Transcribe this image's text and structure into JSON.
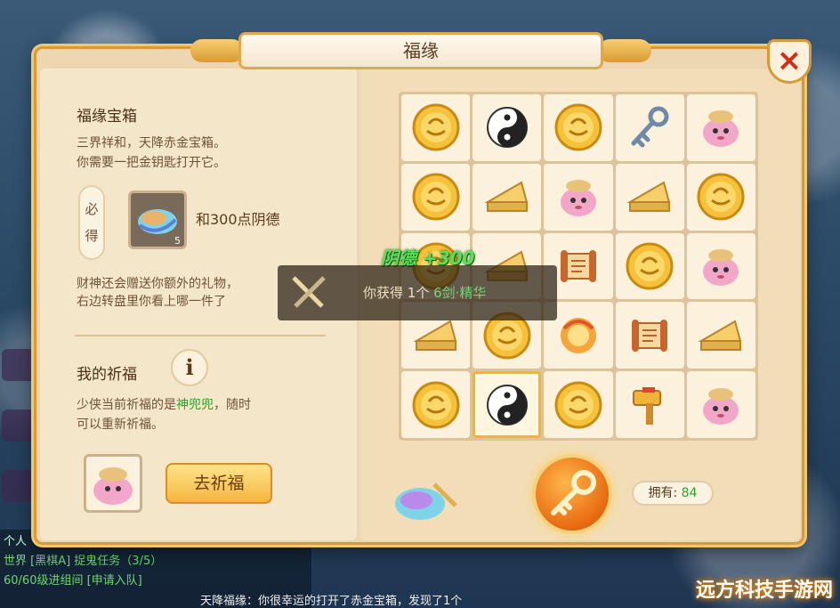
{
  "window": {
    "title": "福缘",
    "close_label": "×"
  },
  "chest": {
    "title": "福缘宝箱",
    "desc_line1": "三界祥和，天降赤金宝箱。",
    "desc_line2": "你需要一把金钥匙打开它。",
    "must_get_label": "必得",
    "reward_text": "和300点阴德",
    "reward_count": "5",
    "extra_line1": "财神还会赠送你额外的礼物，",
    "extra_line2": "右边转盘里你看上哪一件了"
  },
  "blessing": {
    "title": "我的祈福",
    "info_icon": "i",
    "desc_prefix": "少侠当前祈福的是",
    "desc_highlight": "神兜兜",
    "desc_suffix": "，随时",
    "desc_line2": "可以重新祈福。",
    "pray_button": "去祈福"
  },
  "grid": {
    "cells": [
      "gold-coin-icon",
      "yin-yang-icon",
      "gold-coin-icon",
      "silver-key-icon",
      "pet-pot-icon",
      "gold-coin-icon",
      "cheese-wedge-icon",
      "pet-pot-icon",
      "cheese-wedge-icon",
      "gold-coin-icon",
      "gold-coin-icon",
      "cheese-wedge-icon",
      "scroll-icon",
      "gold-coin-icon",
      "pet-pot-icon",
      "cheese-wedge-icon",
      "gold-coin-icon",
      "fire-orb-icon",
      "scroll-icon",
      "cheese-wedge-icon",
      "gold-coin-icon",
      "yin-yang-icon",
      "gold-coin-icon",
      "golden-hammer-icon",
      "pet-pot-icon"
    ],
    "selected_index": 21
  },
  "float_gain": "阴德 +300",
  "toast": {
    "prefix": "你获得",
    "count": "1个",
    "item": "6剑·精华"
  },
  "owned": {
    "label": "拥有:",
    "value": "84"
  },
  "chat": {
    "line1": "个人",
    "line2": "世界 [黑棋A] 捉鬼任务（3/5）",
    "line3": "60/60级进组间 [申请入队]",
    "bottom": "天降福缘：你很幸运的打开了赤金宝箱，发现了1个"
  },
  "watermark": "远方科技手游网",
  "colors": {
    "accent": "#d59a3b",
    "panel": "#ecd7b2",
    "highlight_green": "#2fa12f"
  }
}
